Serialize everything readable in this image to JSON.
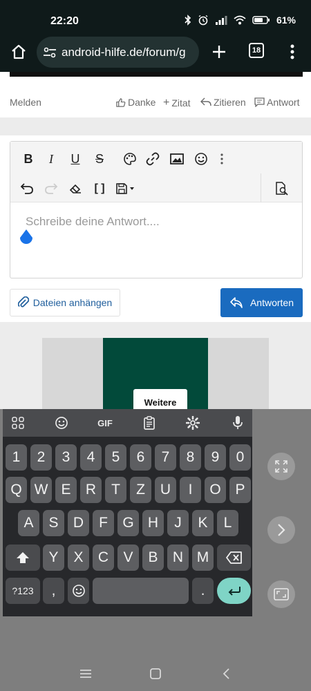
{
  "status": {
    "time": "22:20",
    "battery": "61%"
  },
  "browser": {
    "url": "android-hilfe.de/forum/g",
    "tab_count": "18"
  },
  "post_actions": {
    "report": "Melden",
    "thanks": "Danke",
    "quote_add": "Zitat",
    "quote": "Zitieren",
    "answer": "Antwort"
  },
  "editor": {
    "placeholder": "Schreibe deine Antwort...."
  },
  "buttons": {
    "attach": "Dateien anhängen",
    "reply": "Antworten"
  },
  "ad": {
    "more_label": "Weitere"
  },
  "keyboard": {
    "gif_label": "GIF",
    "number_row": [
      "1",
      "2",
      "3",
      "4",
      "5",
      "6",
      "7",
      "8",
      "9",
      "0"
    ],
    "row1": [
      "Q",
      "W",
      "E",
      "R",
      "T",
      "Z",
      "U",
      "I",
      "O",
      "P"
    ],
    "row2": [
      "A",
      "S",
      "D",
      "F",
      "G",
      "H",
      "J",
      "K",
      "L"
    ],
    "row3": [
      "Y",
      "X",
      "C",
      "V",
      "B",
      "N",
      "M"
    ],
    "symbols_label": "?123",
    "comma": ",",
    "period": "."
  }
}
